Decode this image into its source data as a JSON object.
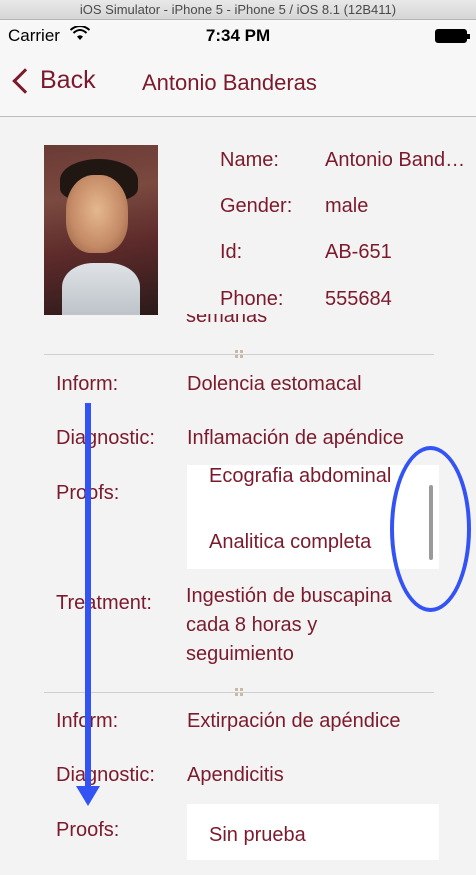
{
  "simulator": {
    "title": "iOS Simulator - iPhone 5 - iPhone 5 / iOS 8.1 (12B411)"
  },
  "status_bar": {
    "carrier": "Carrier",
    "time": "7:34 PM"
  },
  "nav": {
    "back_label": "Back",
    "title": "Antonio Banderas"
  },
  "patient": {
    "name_label": "Name:",
    "name_value": "Antonio Banderas",
    "gender_label": "Gender:",
    "gender_value": "male",
    "id_label": "Id:",
    "id_value": "AB-651",
    "phone_label": "Phone:",
    "phone_value": "555684"
  },
  "cut_off_text": "semanas",
  "records": [
    {
      "inform_label": "Inform:",
      "inform_value": "Dolencia estomacal",
      "diagnostic_label": "Diagnostic:",
      "diagnostic_value": "Inflamación de apéndice",
      "proofs_label": "Proofs:",
      "proofs": [
        "Ecografia abdominal",
        "Analitica completa"
      ],
      "treatment_label": "Treatment:",
      "treatment_value": "Ingestión de buscapina cada 8 horas y seguimiento"
    },
    {
      "inform_label": "Inform:",
      "inform_value": "Extirpación de apéndice",
      "diagnostic_label": "Diagnostic:",
      "diagnostic_value": "Apendicitis",
      "proofs_label": "Proofs:",
      "proofs": [
        "Sin prueba"
      ]
    }
  ],
  "colors": {
    "accent": "#7b1a2c",
    "annotation": "#3353f5",
    "background": "#f3f3f3"
  },
  "icons": {
    "back": "chevron-left-icon",
    "wifi": "wifi-icon",
    "battery": "battery-icon",
    "drag": "drag-handle-icon"
  }
}
